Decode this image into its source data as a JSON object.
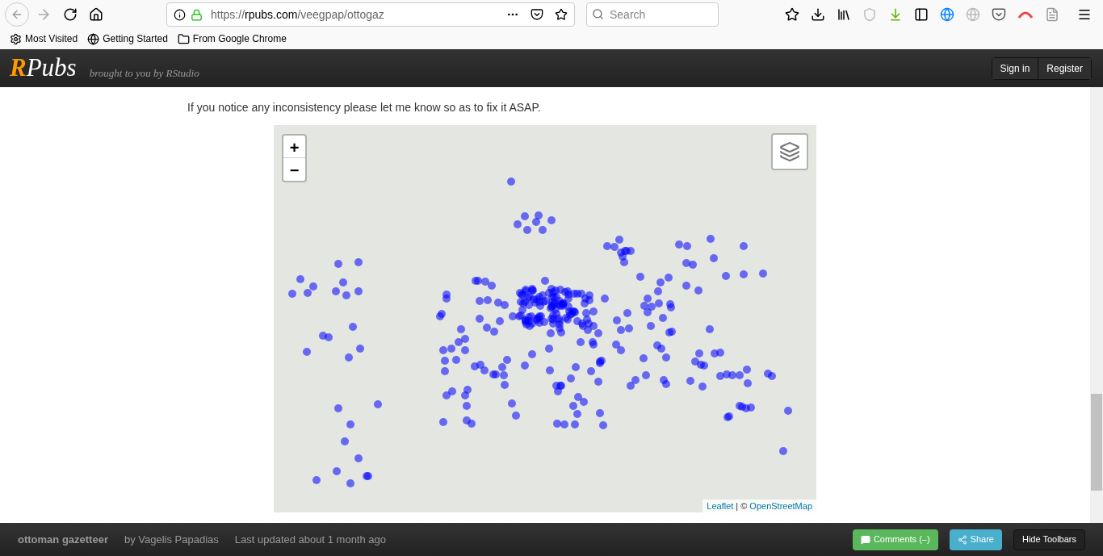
{
  "browser": {
    "url_prefix": "https://",
    "url_host": "rpubs.com",
    "url_path": "/veegpap/ottogaz",
    "search": {
      "placeholder": "Search"
    },
    "bookmarks": [
      {
        "label": "Most Visited",
        "kind": "gear"
      },
      {
        "label": "Getting Started",
        "kind": "globe"
      },
      {
        "label": "From Google Chrome",
        "kind": "folder"
      }
    ]
  },
  "header": {
    "logo_initial": "R",
    "logo_rest": "Pubs",
    "tagline": "brought to you by RStudio",
    "buttons": [
      "Sign in",
      "Register"
    ]
  },
  "content": {
    "paragraph": "If you notice any inconsistency please let me know so as to fix it ASAP.",
    "map": {
      "zoom_in": "+",
      "zoom_out": "−",
      "attribution_link": "Leaflet",
      "attribution_sep": "| ©",
      "attribution_source": "OpenStreetMap"
    }
  },
  "footer": {
    "title": "ottoman gazetteer",
    "author": "by Vagelis Papadias",
    "updated": "Last updated about 1 month ago",
    "comments": "Comments (–)",
    "share": "Share",
    "hide": "Hide Toolbars"
  }
}
